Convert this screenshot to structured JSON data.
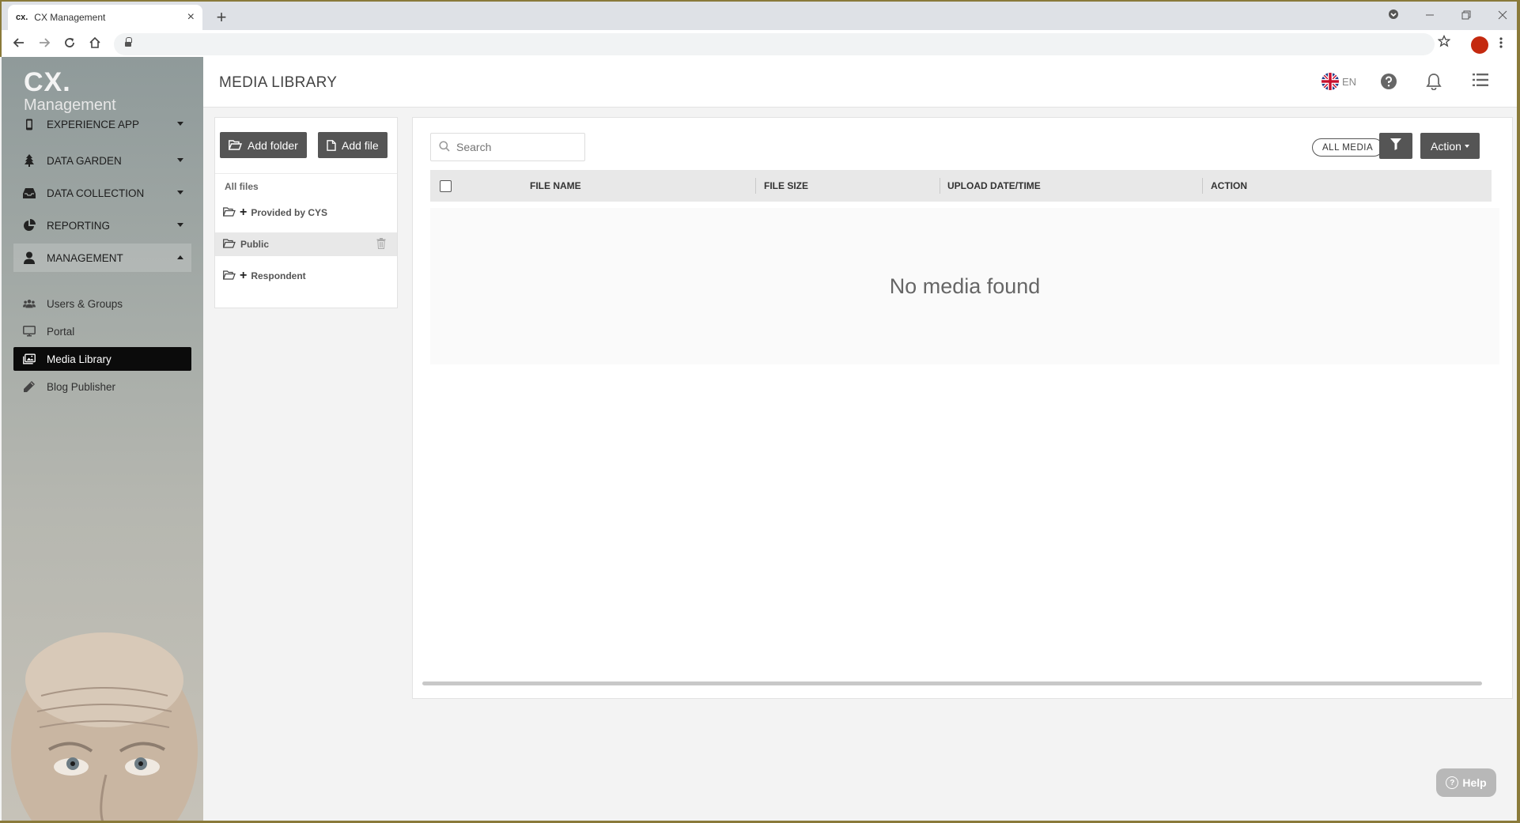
{
  "browser": {
    "tab_favicon": "cx.",
    "tab_title": "CX Management",
    "tab_close": "×",
    "new_tab": "+",
    "window_controls": [
      "minimize",
      "restore",
      "close"
    ]
  },
  "sidebar": {
    "logo_main": "CX.",
    "logo_sub": "Management",
    "groups": [
      {
        "label": "EXPERIENCE APP",
        "icon": "phone-icon"
      },
      {
        "label": "DATA GARDEN",
        "icon": "tree-icon"
      },
      {
        "label": "DATA COLLECTION",
        "icon": "inbox-icon"
      },
      {
        "label": "REPORTING",
        "icon": "pie-chart-icon"
      },
      {
        "label": "MANAGEMENT",
        "icon": "user-icon"
      }
    ],
    "sub_items": [
      {
        "label": "Users & Groups",
        "icon": "users-icon"
      },
      {
        "label": "Portal",
        "icon": "monitor-icon"
      },
      {
        "label": "Media Library",
        "icon": "images-icon"
      },
      {
        "label": "Blog Publisher",
        "icon": "pencil-icon"
      }
    ]
  },
  "header": {
    "title": "MEDIA LIBRARY",
    "language": "EN"
  },
  "folders": {
    "add_folder": "Add folder",
    "add_file": "Add file",
    "all_files": "All files",
    "items": [
      {
        "label": "Provided by CYS",
        "expandable": true
      },
      {
        "label": "Public",
        "expandable": false
      },
      {
        "label": "Respondent",
        "expandable": true
      }
    ]
  },
  "media": {
    "search_placeholder": "Search",
    "all_media": "ALL MEDIA",
    "action": "Action",
    "columns": [
      "FILE NAME",
      "FILE SIZE",
      "UPLOAD DATE/TIME",
      "ACTION"
    ],
    "empty_message": "No media found"
  },
  "help_label": "Help",
  "colors": {
    "button_dark": "#555555",
    "active_nav": "#0b0b0b",
    "profile": "#c4290f"
  }
}
